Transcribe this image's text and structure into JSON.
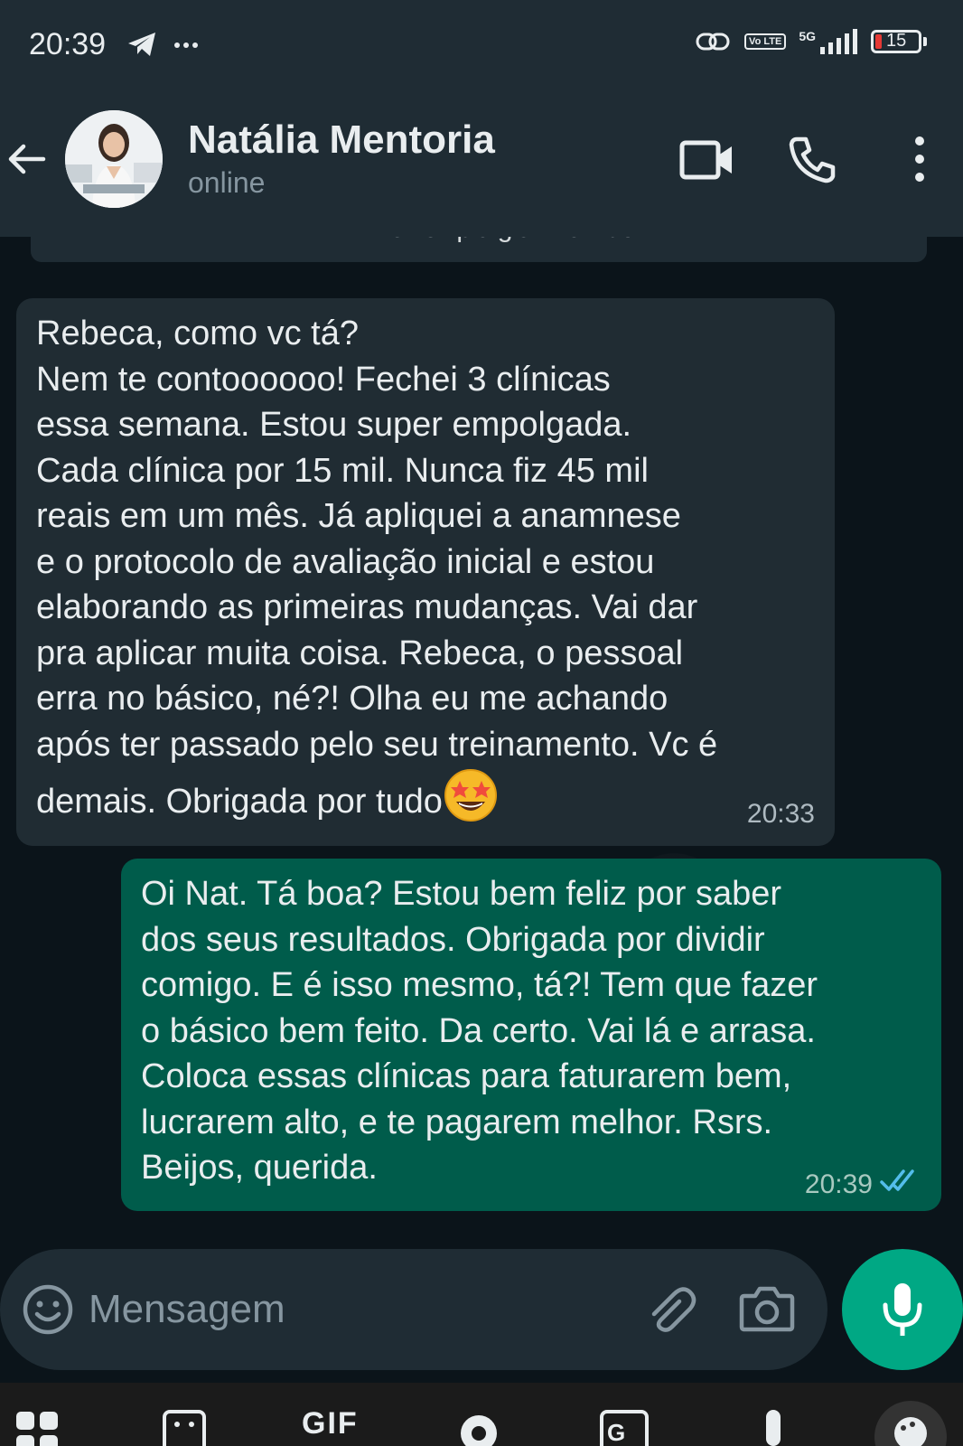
{
  "status_bar": {
    "time": "20:39",
    "network": "5G",
    "volte": "Vo LTE",
    "battery": "15"
  },
  "header": {
    "contact_name": "Natália Mentoria",
    "contact_status": "online"
  },
  "previous_message_partial": "... e o pagamento ...",
  "messages": [
    {
      "direction": "incoming",
      "text": "Rebeca, como vc tá?\nNem te contoooooo! Fechei 3 clínicas\nessa semana. Estou super empolgada.\nCada clínica por 15 mil. Nunca fiz 45 mil\nreais em um mês. Já apliquei a anamnese\ne o protocolo de avaliação inicial e estou\nelaborando as primeiras mudanças. Vai dar\npra aplicar muita coisa. Rebeca, o pessoal\nerra no básico, né?! Olha eu me achando\napós ter passado pelo seu treinamento. Vc é\ndemais. Obrigada por tudo",
      "emoji": "star-struck-emoji",
      "time": "20:33"
    },
    {
      "direction": "outgoing",
      "text": "Oi Nat. Tá boa? Estou bem feliz por saber\ndos seus resultados. Obrigada por dividir\ncomigo. E é isso mesmo, tá?! Tem que fazer\no básico bem feito. Da certo. Vai lá e arrasa.\nColoca essas clínicas para faturarem bem,\nlucrarem alto, e te pagarem melhor. Rsrs.\nBeijos, querida.",
      "time": "20:39",
      "status": "read"
    }
  ],
  "composer": {
    "placeholder": "Mensagem"
  },
  "keyboard_toolbar": {
    "gif_label": "GIF"
  },
  "colors": {
    "header_bg": "#1f2c34",
    "chat_bg": "#0b141a",
    "incoming_bubble": "#202c33",
    "outgoing_bubble": "#005c4b",
    "accent": "#00a884",
    "read_tick": "#53bdeb"
  }
}
